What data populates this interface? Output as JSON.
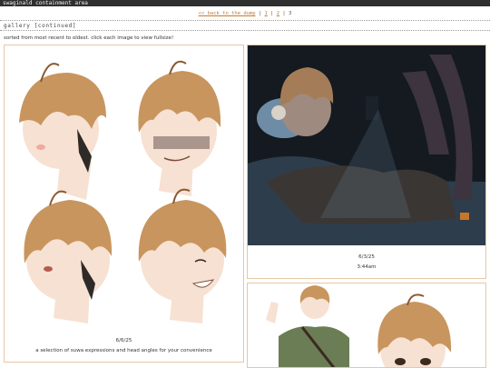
{
  "window": {
    "title": "swaginald containment area"
  },
  "nav": {
    "back_link": "<< back to the dump",
    "sep": "|",
    "pages": [
      {
        "label": "1",
        "link": true
      },
      {
        "label": "2",
        "link": true
      },
      {
        "label": "3",
        "link": false
      }
    ]
  },
  "section": {
    "heading": "gallery [continued]"
  },
  "intro": "sorted from most recent to oldest. click each image to view fullsize!",
  "gallery": [
    {
      "date": "6/6/25",
      "caption": "a selection of suwa expressions and head angles for your convenience"
    },
    {
      "date": "6/3/25",
      "caption": "3:44am"
    },
    {
      "date": "",
      "caption": ""
    }
  ],
  "colors": {
    "accent": "#c57a35",
    "titlebar": "#2f2f2f",
    "border": "#e6c8a6",
    "hair": "#c8955e",
    "skin": "#f7e1d2"
  }
}
